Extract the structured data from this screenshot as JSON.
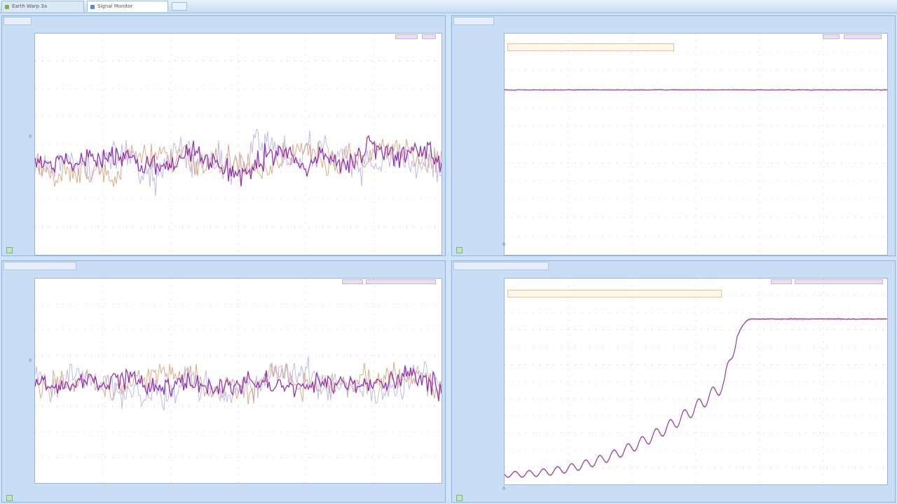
{
  "tabs": [
    {
      "label": "Earth Warp 3a",
      "active": false
    },
    {
      "label": "Signal Monitor",
      "active": true
    }
  ],
  "panels": [
    {
      "id": "p1",
      "title": "",
      "plot_label": "",
      "legend": "",
      "y_ticks": [
        "",
        "",
        "",
        "",
        "0",
        "",
        "",
        "",
        ""
      ],
      "x_ticks": [
        "",
        "",
        "",
        "",
        ""
      ],
      "kind": "noise-a"
    },
    {
      "id": "p2",
      "title": "",
      "plot_label": "",
      "legend": "",
      "y_ticks": [
        "",
        "",
        "",
        "",
        "",
        "",
        "",
        "",
        "",
        "",
        "",
        "",
        "",
        ""
      ],
      "x_ticks": [
        "0",
        "",
        "",
        "",
        "",
        "",
        ""
      ],
      "kind": "flat"
    },
    {
      "id": "p3",
      "title": "",
      "plot_label": "",
      "legend": "",
      "y_ticks": [
        "",
        "",
        "0",
        "",
        "",
        ""
      ],
      "x_ticks": [
        "",
        "",
        "",
        "",
        ""
      ],
      "kind": "noise-b"
    },
    {
      "id": "p4",
      "title": "",
      "plot_label": "",
      "legend": "",
      "y_ticks": [
        "",
        "",
        "",
        "",
        "",
        "",
        "",
        "",
        "",
        "",
        "",
        "",
        "",
        ""
      ],
      "x_ticks": [
        "0",
        "",
        "",
        "",
        "",
        "",
        ""
      ],
      "kind": "ramp"
    }
  ],
  "colors": {
    "signal_primary": "#8a1fa8",
    "signal_secondary": "#d9a27a",
    "signal_faint": "#b9b2ec",
    "plot_bg": "#ffffff",
    "frame_bg": "#c9def4"
  },
  "icons": [
    "tab-doc-icon",
    "chart-corner-icon"
  ]
}
